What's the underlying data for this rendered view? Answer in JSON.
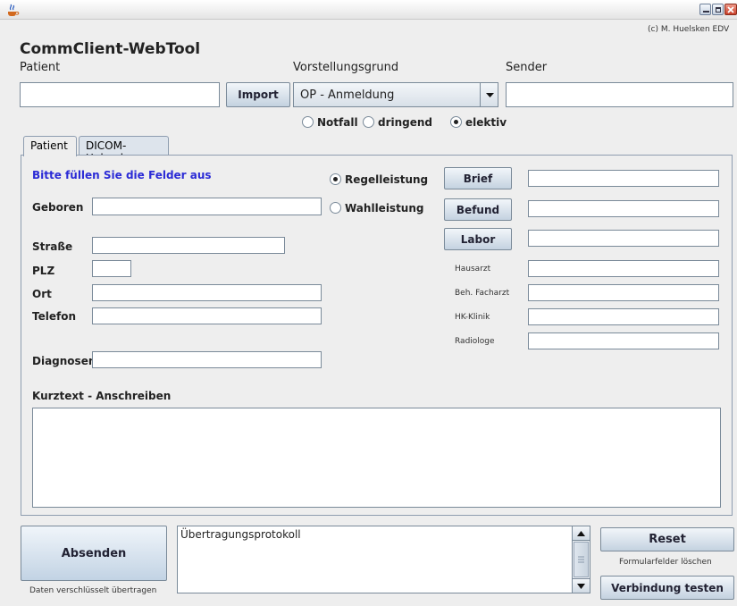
{
  "window": {
    "copyright": "(c) M. Huelsken EDV"
  },
  "app": {
    "title": "CommClient-WebTool"
  },
  "header": {
    "patient_label": "Patient",
    "patient_value": "",
    "import_label": "Import",
    "vorstellung_label": "Vorstellungsgrund",
    "vorstellung_value": "OP - Anmeldung",
    "sender_label": "Sender",
    "sender_value": "",
    "urgency": [
      {
        "label": "Notfall",
        "checked": false
      },
      {
        "label": "dringend",
        "checked": false
      },
      {
        "label": "elektiv",
        "checked": true
      }
    ]
  },
  "tabs": [
    {
      "label": "Patient",
      "active": true
    },
    {
      "label": "DICOM-Upload",
      "active": false
    }
  ],
  "form": {
    "instruction": "Bitte füllen Sie die Felder aus",
    "geboren_label": "Geboren",
    "strasse_label": "Straße",
    "plz_label": "PLZ",
    "ort_label": "Ort",
    "telefon_label": "Telefon",
    "diagnosen_label": "Diagnosen",
    "regelleistung_label": "Regelleistung",
    "wahlleistung_label": "Wahlleistung",
    "brief_label": "Brief",
    "befund_label": "Befund",
    "labor_label": "Labor",
    "hausarzt_label": "Hausarzt",
    "facharzt_label": "Beh. Facharzt",
    "hk_klinik_label": "HK-Klinik",
    "radiologe_label": "Radiologe",
    "kurztext_label": "Kurztext - Anschreiben"
  },
  "footer": {
    "send_label": "Absenden",
    "encrypt_note": "Daten verschlüsselt übertragen",
    "protocol_text": "Übertragungsprotokoll",
    "reset_label": "Reset",
    "clear_note": "Formularfelder löschen",
    "test_label": "Verbindung testen"
  },
  "colors": {
    "instruction": "#2b2bd6",
    "accent": "#c4d2e0"
  }
}
